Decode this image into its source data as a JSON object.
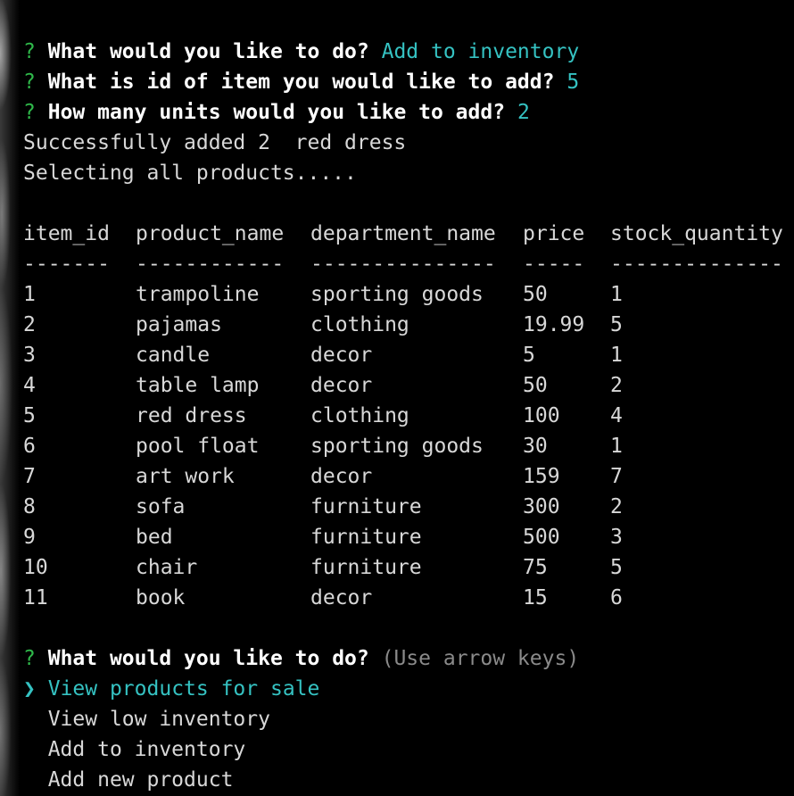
{
  "prompts": [
    {
      "mark": "?",
      "question": "What would you like to do?",
      "answer": "Add to inventory"
    },
    {
      "mark": "?",
      "question": "What is id of item you would like to add?",
      "answer": "5"
    },
    {
      "mark": "?",
      "question": "How many units would you like to add?",
      "answer": "2"
    }
  ],
  "messages": [
    "Successfully added 2  red dress",
    "Selecting all products....."
  ],
  "table": {
    "headers": [
      "item_id",
      "product_name",
      "department_name",
      "price",
      "stock_quantity"
    ],
    "separators": [
      "-------",
      "------------",
      "---------------",
      "-----",
      "--------------"
    ],
    "rows": [
      [
        "1",
        "trampoline",
        "sporting goods",
        "50",
        "1"
      ],
      [
        "2",
        "pajamas",
        "clothing",
        "19.99",
        "5"
      ],
      [
        "3",
        "candle",
        "decor",
        "5",
        "1"
      ],
      [
        "4",
        "table lamp",
        "decor",
        "50",
        "2"
      ],
      [
        "5",
        "red dress",
        "clothing",
        "100",
        "4"
      ],
      [
        "6",
        "pool float",
        "sporting goods",
        "30",
        "1"
      ],
      [
        "7",
        "art work",
        "decor",
        "159",
        "7"
      ],
      [
        "8",
        "sofa",
        "furniture",
        "300",
        "2"
      ],
      [
        "9",
        "bed",
        "furniture",
        "500",
        "3"
      ],
      [
        "10",
        "chair",
        "furniture",
        "75",
        "5"
      ],
      [
        "11",
        "book",
        "decor",
        "15",
        "6"
      ]
    ]
  },
  "menu": {
    "mark": "?",
    "question": "What would you like to do?",
    "hint": "(Use arrow keys)",
    "pointer": "❯",
    "options": [
      "View products for sale",
      "View low inventory",
      "Add to inventory",
      "Add new product"
    ]
  },
  "colors": {
    "background": "#000000",
    "prompt_mark": "#2fb84a",
    "answer": "#35c2c2",
    "text": "#d8d8d8",
    "hint": "#8a8a8a"
  }
}
